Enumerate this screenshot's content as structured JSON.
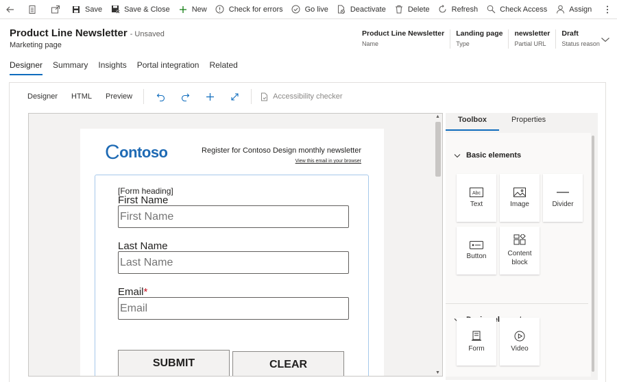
{
  "command_bar": {
    "save": "Save",
    "save_close": "Save & Close",
    "new": "New",
    "check_errors": "Check for errors",
    "go_live": "Go live",
    "deactivate": "Deactivate",
    "delete": "Delete",
    "refresh": "Refresh",
    "check_access": "Check Access",
    "assign": "Assign"
  },
  "header": {
    "title": "Product Line Newsletter",
    "status": "- Unsaved",
    "entity": "Marketing page",
    "fields": [
      {
        "value": "Product Line Newsletter",
        "label": "Name"
      },
      {
        "value": "Landing page",
        "label": "Type"
      },
      {
        "value": "newsletter",
        "label": "Partial URL"
      },
      {
        "value": "Draft",
        "label": "Status reason"
      }
    ]
  },
  "tabs": [
    "Designer",
    "Summary",
    "Insights",
    "Portal integration",
    "Related"
  ],
  "designer_toolbar": {
    "designer": "Designer",
    "html": "HTML",
    "preview": "Preview",
    "accessibility": "Accessibility checker"
  },
  "canvas": {
    "logo": "ontoso",
    "logo_c": "C",
    "register_text": "Register for Contoso Design monthly newsletter",
    "view_link": "View this email in your browser",
    "form": {
      "heading": "[Form heading]",
      "first_name_label": "First Name",
      "first_name_placeholder": "First Name",
      "last_name_label": "Last Name",
      "last_name_placeholder": "Last Name",
      "email_label": "Email",
      "email_required": "*",
      "email_placeholder": "Email",
      "submit": "SUBMIT",
      "clear": "CLEAR"
    }
  },
  "panel": {
    "tabs": [
      "Toolbox",
      "Properties"
    ],
    "basic_section": "Basic elements",
    "basic": [
      "Text",
      "Image",
      "Divider",
      "Button",
      "Content block"
    ],
    "design_section": "Design elements",
    "design": [
      "Form",
      "Video"
    ]
  },
  "colors": {
    "accent": "#0f6cbd",
    "logo": "#1e6ab4",
    "required": "#c50f1f"
  }
}
